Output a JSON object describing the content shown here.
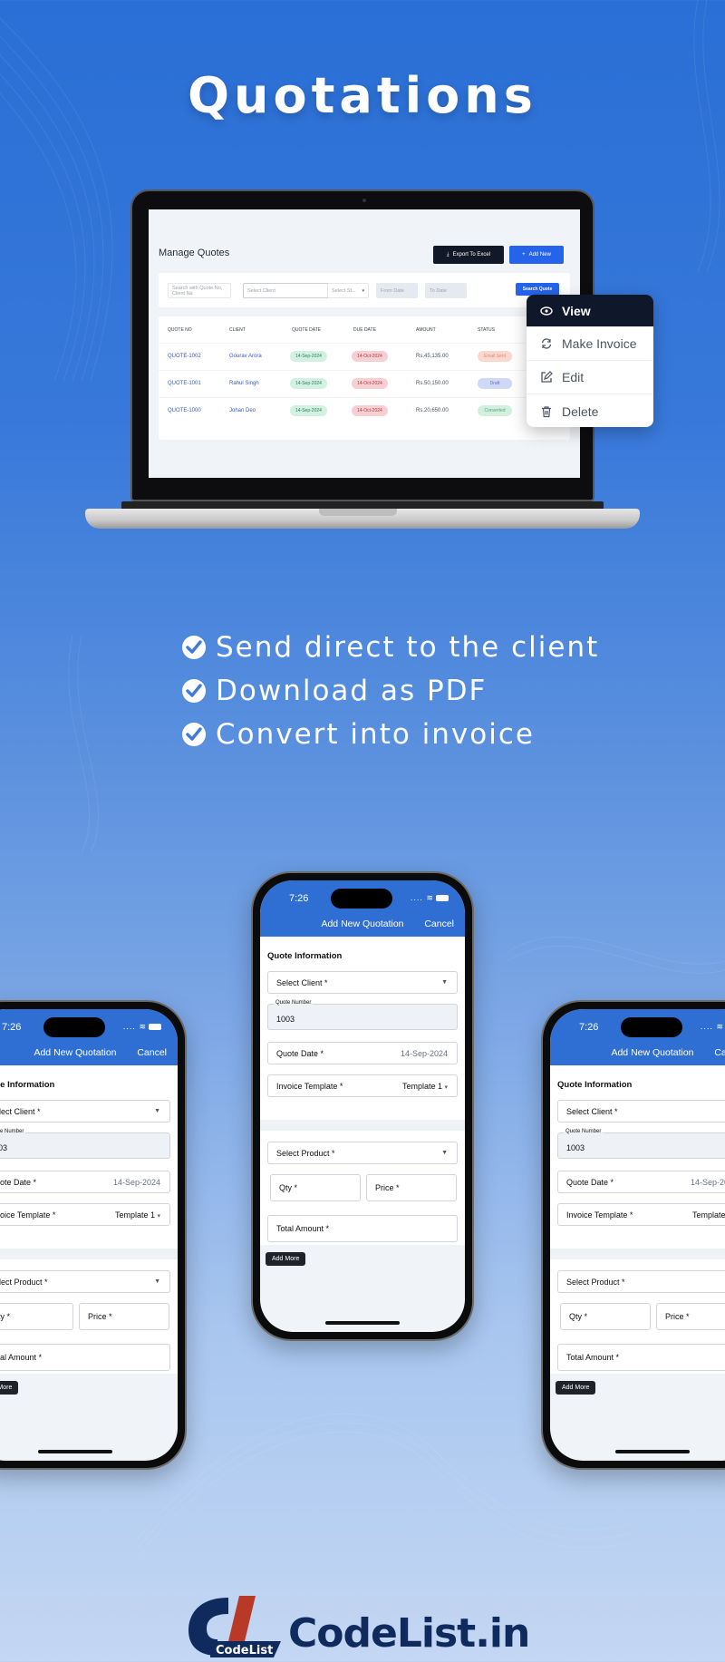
{
  "page": {
    "title": "Quotations",
    "features": [
      "Send direct to the client",
      "Download as PDF",
      "Convert into invoice"
    ],
    "brand": {
      "mark_label": "CodeList",
      "name": "CodeList.in"
    },
    "colors": {
      "primary_blue": "#2f6fd4",
      "dark_button": "#111827",
      "accent_blue": "#2563eb",
      "brand_navy": "#0f2a5c",
      "brand_red": "#b83a26"
    }
  },
  "desktop": {
    "page_title": "Manage Quotes",
    "export_button": "Export To Excel",
    "add_button": "Add New",
    "filters": {
      "search_placeholder": "Search with Quote No, Client Na",
      "client_select": "Select Client",
      "status_select": "Select St...",
      "from_date": "From Date",
      "to_date": "To Date",
      "search_button": "Search Quote"
    },
    "table": {
      "headers": [
        "QUOTE NO",
        "CLIENT",
        "QUOTE DATE",
        "DUE DATE",
        "AMOUNT",
        "STATUS"
      ],
      "rows": [
        {
          "quote_no": "QUOTE-1002",
          "client": "Gourav Arora",
          "quote_date": "14-Sep-2024",
          "due_date": "14-Oct-2024",
          "amount": "Rs.45,135.00",
          "status": "Email Sent",
          "status_color": "#f9d8cf",
          "status_text_color": "#e58a73"
        },
        {
          "quote_no": "QUOTE-1001",
          "client": "Rahul Singh",
          "quote_date": "14-Sep-2024",
          "due_date": "14-Oct-2024",
          "amount": "Rs.50,150.00",
          "status": "Draft",
          "status_color": "#cfd8f7",
          "status_text_color": "#5b6fd1"
        },
        {
          "quote_no": "QUOTE-1000",
          "client": "Johan Deo",
          "quote_date": "14-Sep-2024",
          "due_date": "14-Oct-2024",
          "amount": "Rs.20,650.00",
          "status": "Converted",
          "status_color": "#d3f0df",
          "status_text_color": "#4aa876"
        }
      ]
    },
    "context_menu": [
      {
        "label": "View",
        "icon": "eye-icon",
        "active": true
      },
      {
        "label": "Make Invoice",
        "icon": "refresh-icon",
        "active": false
      },
      {
        "label": "Edit",
        "icon": "edit-icon",
        "active": false
      },
      {
        "label": "Delete",
        "icon": "trash-icon",
        "active": false
      }
    ]
  },
  "mobile": {
    "time": "7:26",
    "signal": "....",
    "header_title": "Add New Quotation",
    "cancel": "Cancel",
    "section_title": "Quote Information",
    "select_client": "Select Client *",
    "quote_number_label": "Quote Number",
    "quote_number_value": "1003",
    "quote_date_label": "Quote Date *",
    "quote_date_value": "14-Sep-2024",
    "invoice_template_label": "Invoice Template *",
    "invoice_template_value": "Template 1",
    "select_product": "Select Product *",
    "qty": "Qty *",
    "price": "Price *",
    "total_amount": "Total Amount *",
    "add_more": "Add More"
  }
}
